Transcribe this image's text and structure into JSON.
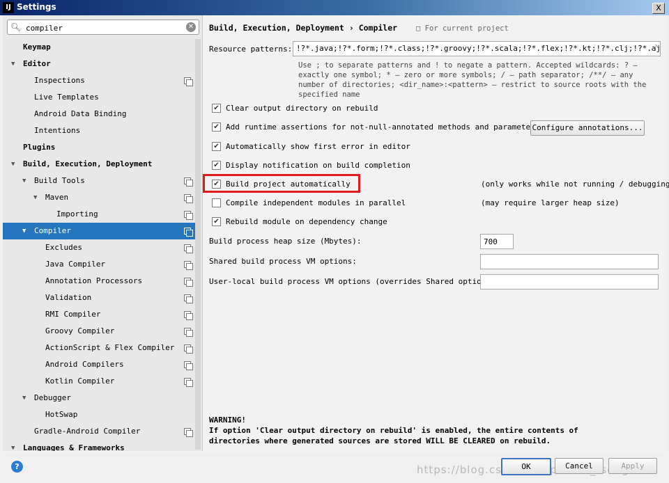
{
  "window": {
    "title": "Settings",
    "app_icon": "IJ",
    "close_label": "X"
  },
  "search": {
    "value": "compiler"
  },
  "tree": [
    {
      "label": "Keymap",
      "level": 0,
      "bold": true,
      "arrow": "",
      "copy": false,
      "selected": false
    },
    {
      "label": "Editor",
      "level": 0,
      "bold": true,
      "arrow": "v",
      "copy": false,
      "selected": false
    },
    {
      "label": "Inspections",
      "level": 1,
      "bold": false,
      "arrow": "",
      "copy": true,
      "selected": false
    },
    {
      "label": "Live Templates",
      "level": 1,
      "bold": false,
      "arrow": "",
      "copy": false,
      "selected": false
    },
    {
      "label": "Android Data Binding",
      "level": 1,
      "bold": false,
      "arrow": "",
      "copy": false,
      "selected": false
    },
    {
      "label": "Intentions",
      "level": 1,
      "bold": false,
      "arrow": "",
      "copy": false,
      "selected": false
    },
    {
      "label": "Plugins",
      "level": 0,
      "bold": true,
      "arrow": "",
      "copy": false,
      "selected": false
    },
    {
      "label": "Build, Execution, Deployment",
      "level": 0,
      "bold": true,
      "arrow": "v",
      "copy": false,
      "selected": false
    },
    {
      "label": "Build Tools",
      "level": 1,
      "bold": false,
      "arrow": "v",
      "copy": true,
      "selected": false
    },
    {
      "label": "Maven",
      "level": 2,
      "bold": false,
      "arrow": "v",
      "copy": true,
      "selected": false
    },
    {
      "label": "Importing",
      "level": 3,
      "bold": false,
      "arrow": "",
      "copy": true,
      "selected": false
    },
    {
      "label": "Compiler",
      "level": 1,
      "bold": false,
      "arrow": "v",
      "copy": true,
      "selected": true
    },
    {
      "label": "Excludes",
      "level": 2,
      "bold": false,
      "arrow": "",
      "copy": true,
      "selected": false
    },
    {
      "label": "Java Compiler",
      "level": 2,
      "bold": false,
      "arrow": "",
      "copy": true,
      "selected": false
    },
    {
      "label": "Annotation Processors",
      "level": 2,
      "bold": false,
      "arrow": "",
      "copy": true,
      "selected": false
    },
    {
      "label": "Validation",
      "level": 2,
      "bold": false,
      "arrow": "",
      "copy": true,
      "selected": false
    },
    {
      "label": "RMI Compiler",
      "level": 2,
      "bold": false,
      "arrow": "",
      "copy": true,
      "selected": false
    },
    {
      "label": "Groovy Compiler",
      "level": 2,
      "bold": false,
      "arrow": "",
      "copy": true,
      "selected": false
    },
    {
      "label": "ActionScript & Flex Compiler",
      "level": 2,
      "bold": false,
      "arrow": "",
      "copy": true,
      "selected": false
    },
    {
      "label": "Android Compilers",
      "level": 2,
      "bold": false,
      "arrow": "",
      "copy": true,
      "selected": false
    },
    {
      "label": "Kotlin Compiler",
      "level": 2,
      "bold": false,
      "arrow": "",
      "copy": true,
      "selected": false
    },
    {
      "label": "Debugger",
      "level": 1,
      "bold": false,
      "arrow": "v",
      "copy": false,
      "selected": false
    },
    {
      "label": "HotSwap",
      "level": 2,
      "bold": false,
      "arrow": "",
      "copy": false,
      "selected": false
    },
    {
      "label": "Gradle-Android Compiler",
      "level": 1,
      "bold": false,
      "arrow": "",
      "copy": true,
      "selected": false
    },
    {
      "label": "Languages & Frameworks",
      "level": 0,
      "bold": true,
      "arrow": "v",
      "copy": false,
      "selected": false
    }
  ],
  "breadcrumb": {
    "path": "Build, Execution, Deployment",
    "sep": "›",
    "current": "Compiler",
    "scope": "For current project"
  },
  "resource_patterns": {
    "label": "Resource patterns:",
    "value": "!?*.java;!?*.form;!?*.class;!?*.groovy;!?*.scala;!?*.flex;!?*.kt;!?*.clj;!?*.aj",
    "help": [
      "Use ; to separate patterns and ! to negate a pattern. Accepted wildcards: ? —",
      "exactly one symbol; * — zero or more symbols; / — path separator; /**/ — any",
      "number of directories; <dir_name>:<pattern> — restrict to source roots with the",
      "specified name"
    ]
  },
  "options": [
    {
      "label": "Clear output directory on rebuild",
      "checked": true,
      "note": ""
    },
    {
      "label": "Add runtime assertions for not-null-annotated methods and parameters",
      "checked": true,
      "note": ""
    },
    {
      "label": "Automatically show first error in editor",
      "checked": true,
      "note": ""
    },
    {
      "label": "Display notification on build completion",
      "checked": true,
      "note": ""
    },
    {
      "label": "Build project automatically",
      "checked": true,
      "note": "(only works while not running / debugging)"
    },
    {
      "label": "Compile independent modules in parallel",
      "checked": false,
      "note": "(may require larger heap size)"
    },
    {
      "label": "Rebuild module on dependency change",
      "checked": true,
      "note": ""
    }
  ],
  "configure_button": "Configure annotations...",
  "heap": {
    "label": "Build process heap size (Mbytes):",
    "value": "700"
  },
  "shared_vm": {
    "label": "Shared build process VM options:",
    "value": ""
  },
  "user_vm": {
    "label": "User-local build process VM options (overrides Shared options):",
    "value": ""
  },
  "warning": {
    "title": "WARNING!",
    "line1": "If option 'Clear output directory on rebuild' is enabled, the entire contents of",
    "line2": "directories where generated sources are stored WILL BE CLEARED on rebuild."
  },
  "buttons": {
    "ok": "OK",
    "cancel": "Cancel",
    "apply": "Apply",
    "help": "?"
  },
  "watermark": "https://blog.csdn.net/spencer_tseng",
  "colors": {
    "selection": "#2675bf",
    "highlight_box": "#e21a1a",
    "help_button": "#2b7cd3"
  }
}
